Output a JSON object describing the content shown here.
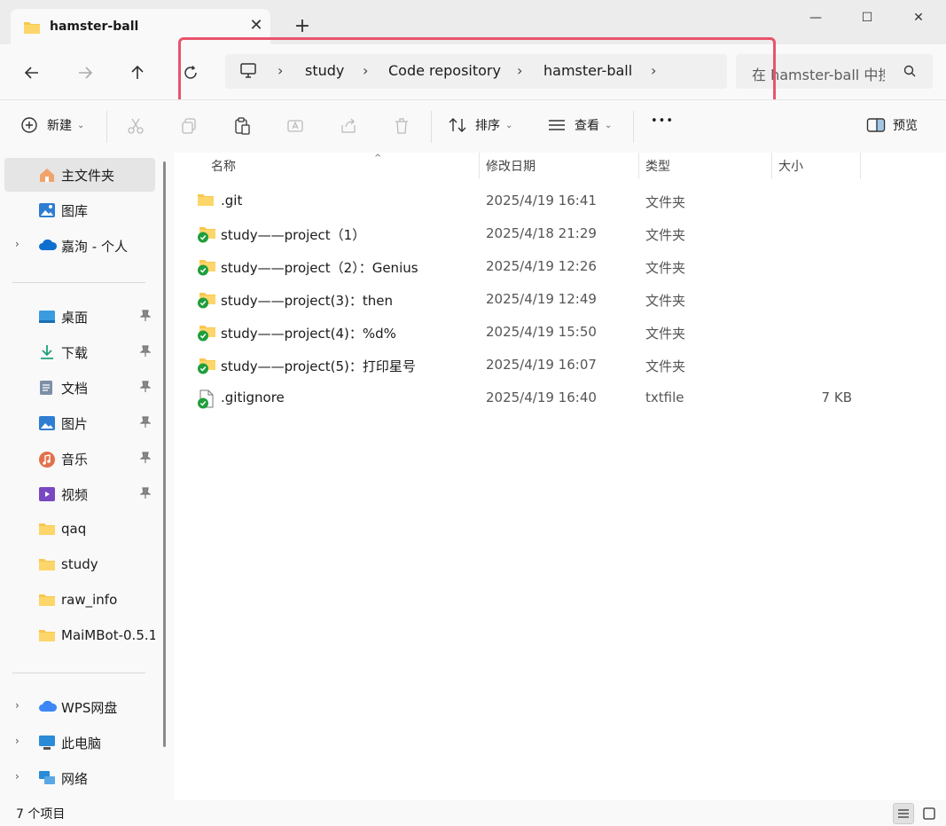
{
  "tab": {
    "title": "hamster-ball"
  },
  "address": {
    "crumbs": [
      "study",
      "Code repository",
      "hamster-ball"
    ]
  },
  "search": {
    "placeholder": "在 hamster-ball 中搜索"
  },
  "toolbar": {
    "new_label": "新建",
    "sort_label": "排序",
    "view_label": "查看",
    "more_label": "•••",
    "preview_label": "预览"
  },
  "sidebar": {
    "items": [
      {
        "label": "主文件夹",
        "icon": "home-icon"
      },
      {
        "label": "图库",
        "icon": "gallery-icon"
      },
      {
        "label": "嘉洵 - 个人",
        "icon": "onedrive-icon"
      },
      {
        "label": "桌面",
        "icon": "desktop-icon"
      },
      {
        "label": "下载",
        "icon": "download-icon"
      },
      {
        "label": "文档",
        "icon": "document-icon"
      },
      {
        "label": "图片",
        "icon": "pictures-icon"
      },
      {
        "label": "音乐",
        "icon": "music-icon"
      },
      {
        "label": "视频",
        "icon": "video-icon"
      },
      {
        "label": "qaq",
        "icon": "folder-icon"
      },
      {
        "label": "study",
        "icon": "folder-icon"
      },
      {
        "label": "raw_info",
        "icon": "folder-icon"
      },
      {
        "label": "MaiMBot-0.5.1",
        "icon": "folder-icon"
      },
      {
        "label": "WPS网盘",
        "icon": "wps-cloud-icon"
      },
      {
        "label": "此电脑",
        "icon": "computer-icon"
      },
      {
        "label": "网络",
        "icon": "network-icon"
      }
    ]
  },
  "columns": {
    "name": "名称",
    "date": "修改日期",
    "type": "类型",
    "size": "大小"
  },
  "files": [
    {
      "name": ".git",
      "date": "2025/4/19 16:41",
      "type": "文件夹",
      "size": "",
      "kind": "folder"
    },
    {
      "name": "study——project（1）",
      "date": "2025/4/18 21:29",
      "type": "文件夹",
      "size": "",
      "kind": "folder-synced"
    },
    {
      "name": "study——project（2）：Genius",
      "date": "2025/4/19 12:26",
      "type": "文件夹",
      "size": "",
      "kind": "folder-synced"
    },
    {
      "name": "study——project(3)：then",
      "date": "2025/4/19 12:49",
      "type": "文件夹",
      "size": "",
      "kind": "folder-synced"
    },
    {
      "name": "study——project(4)：%d%",
      "date": "2025/4/19 15:50",
      "type": "文件夹",
      "size": "",
      "kind": "folder-synced"
    },
    {
      "name": "study——project(5)：打印星号",
      "date": "2025/4/19 16:07",
      "type": "文件夹",
      "size": "",
      "kind": "folder-synced"
    },
    {
      "name": ".gitignore",
      "date": "2025/4/19 16:40",
      "type": "txtfile",
      "size": "7 KB",
      "kind": "file-synced"
    }
  ],
  "status": {
    "count": "7 个项目"
  },
  "colors": {
    "highlight": "#e9546b",
    "folder": "#f8c74e",
    "synced": "#1e9e3c"
  }
}
